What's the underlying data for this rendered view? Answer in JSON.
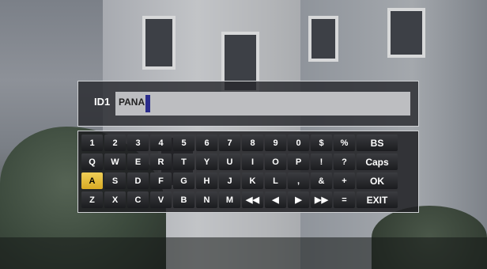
{
  "id_entry": {
    "label": "ID1",
    "value": "PANA"
  },
  "keyboard": {
    "selected_key": "A",
    "rows": [
      [
        "1",
        "2",
        "3",
        "4",
        "5",
        "6",
        "7",
        "8",
        "9",
        "0",
        "$",
        "%",
        "BS"
      ],
      [
        "Q",
        "W",
        "E",
        "R",
        "T",
        "Y",
        "U",
        "I",
        "O",
        "P",
        "!",
        "?",
        "Caps"
      ],
      [
        "A",
        "S",
        "D",
        "F",
        "G",
        "H",
        "J",
        "K",
        "L",
        ",",
        "&",
        "+",
        "OK"
      ],
      [
        "Z",
        "X",
        "C",
        "V",
        "B",
        "N",
        "M",
        "◀◀",
        "◀",
        "▶",
        "▶▶",
        "=",
        "EXIT"
      ]
    ]
  },
  "colors": {
    "highlight": "#e6bd3c",
    "cursor": "#2a2c8c"
  }
}
